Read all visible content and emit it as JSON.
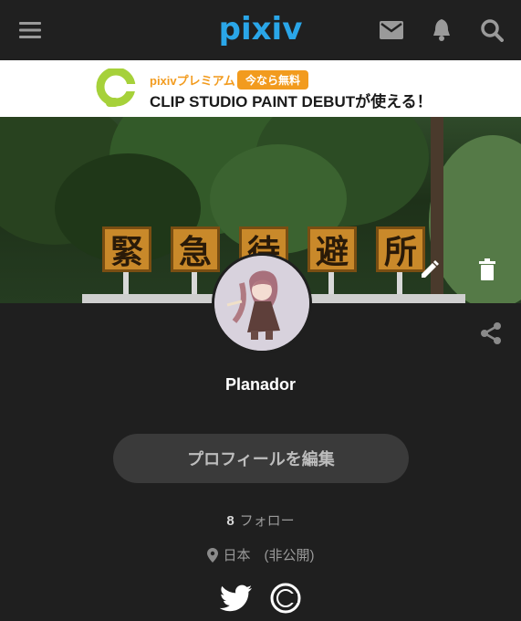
{
  "header": {
    "logo_text": "pixiv",
    "menu_icon": "hamburger-menu-icon",
    "mail_icon": "mail-icon",
    "bell_icon": "bell-icon",
    "search_icon": "search-icon"
  },
  "banner": {
    "brand": "pixivプレミアム",
    "badge": "今なら無料",
    "headline": "CLIP STUDIO PAINT DEBUTが使える！",
    "logo_icon": "clip-studio-logo-icon"
  },
  "cover": {
    "sign_chars": [
      "緊",
      "急",
      "待",
      "避",
      "所"
    ],
    "edit_icon": "pencil-icon",
    "delete_icon": "trash-icon"
  },
  "profile": {
    "username": "Planador",
    "edit_button": "プロフィールを編集",
    "follow_count": "8",
    "follow_label": "フォロー",
    "location": "日本　(非公開)",
    "share_icon": "share-icon",
    "social": [
      "twitter-icon",
      "circle-logo-icon"
    ]
  },
  "colors": {
    "accent": "#2aa6e8",
    "premium": "#f29b1e",
    "background": "#1f1f1f"
  }
}
